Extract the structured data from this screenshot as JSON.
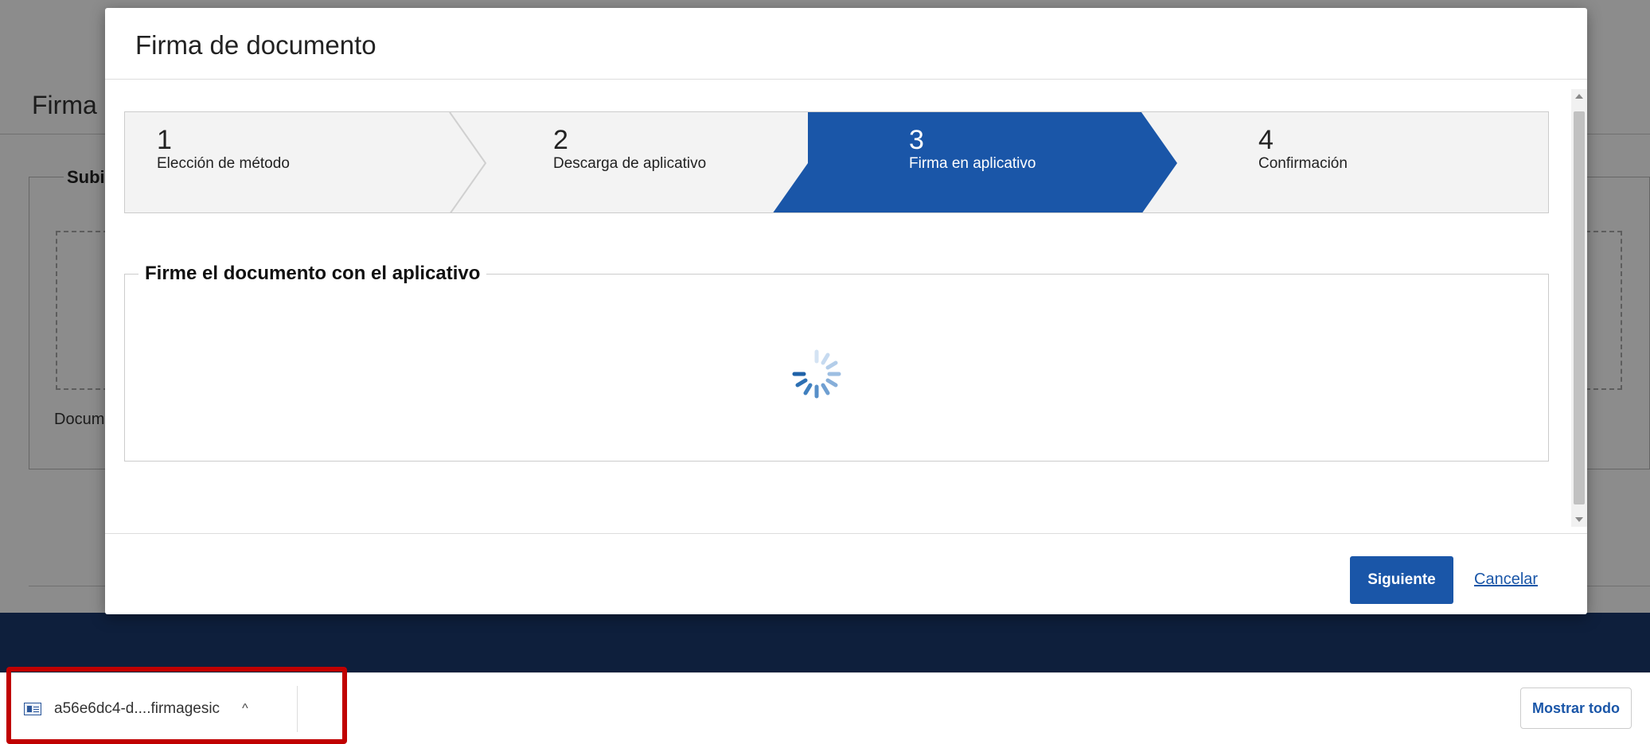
{
  "background": {
    "page_title": "Firma",
    "fieldset_legend": "Subi",
    "doc_label": "Docum"
  },
  "modal": {
    "title": "Firma de documento",
    "steps": [
      {
        "number": "1",
        "label": "Elección de método"
      },
      {
        "number": "2",
        "label": "Descarga de aplicativo"
      },
      {
        "number": "3",
        "label": "Firma en aplicativo",
        "active": true
      },
      {
        "number": "4",
        "label": "Confirmación"
      }
    ],
    "section_legend": "Firme el documento con el aplicativo",
    "next_label": "Siguiente",
    "cancel_label": "Cancelar"
  },
  "download_bar": {
    "file_name": "a56e6dc4-d....firmagesic",
    "chevron": "^",
    "show_all_label": "Mostrar todo"
  },
  "colors": {
    "accent": "#1a56a8",
    "footer": "#1a3a6e",
    "highlight": "#c00000"
  }
}
